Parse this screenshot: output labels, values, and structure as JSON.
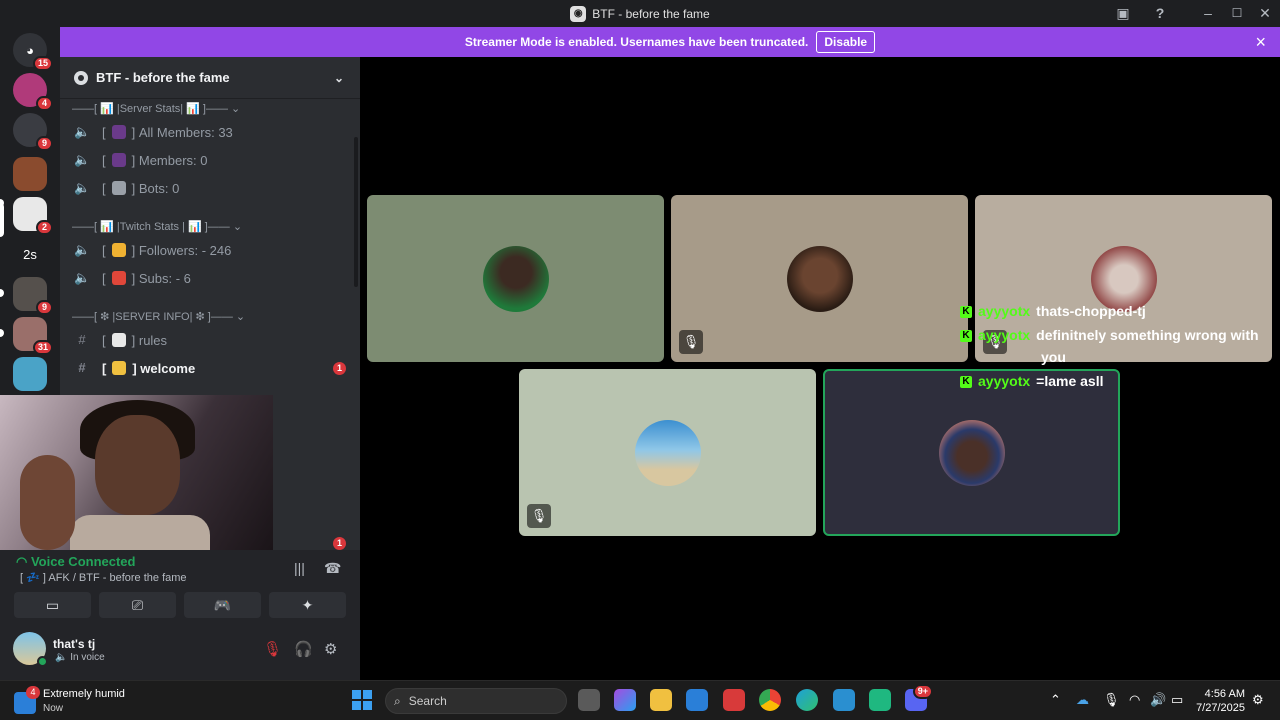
{
  "window": {
    "title": "BTF - before the fame"
  },
  "banner": {
    "text": "Streamer Mode is enabled. Usernames have been truncated.",
    "disable_label": "Disable",
    "close_glyph": "×"
  },
  "servers": [
    {
      "name": "discord-home",
      "badge": "15",
      "color": "#313338"
    },
    {
      "name": "server-2",
      "badge": "4",
      "color": "#b03a7a"
    },
    {
      "name": "server-3",
      "badge": "9",
      "color": "#3a3c42"
    },
    {
      "name": "server-4",
      "badge": "",
      "color": "#8a4b2e"
    },
    {
      "name": "server-5",
      "badge": "2",
      "color": "#e8e8e8"
    },
    {
      "name": "server-6",
      "label": "2s",
      "badge": "",
      "color": "#1e1f22"
    },
    {
      "name": "server-7",
      "badge": "9",
      "color": "#55504c"
    },
    {
      "name": "server-8",
      "badge": "31",
      "color": "#9a6f6a"
    },
    {
      "name": "server-9",
      "badge": "",
      "color": "#4aa3c7"
    }
  ],
  "sidebar": {
    "server_name": "BTF - before the fame",
    "categories": {
      "server_stats": "——[ 📊 |Server Stats| 📊 ]——",
      "twitch_stats": "——[ 📊 |Twitch Stats | 📊 ]——",
      "server_info": "——[ ❇ |SERVER INFO| ❇ ]——"
    },
    "channels": {
      "all_members": "All Members: 33",
      "members": "Members: 0",
      "bots": "Bots: 0",
      "followers": "Followers: - 246",
      "subs": "Subs: - 6",
      "rules": "rules",
      "welcome": "welcome"
    },
    "welcome_badge": "1",
    "lower_badge": "1"
  },
  "voice": {
    "status": "Voice Connected",
    "channel": "[ 💤 ]  AFK / BTF - before the fame"
  },
  "user": {
    "name": "that's tj",
    "status": "In voice"
  },
  "chat": [
    {
      "user": "ayyyotx",
      "message": "thats-chopped-tj"
    },
    {
      "user": "ayyyotx",
      "message": "definitnely something wrong with"
    },
    {
      "user": "",
      "message": "you"
    },
    {
      "user": "ayyyotx",
      "message": "=lame asll"
    }
  ],
  "taskbar": {
    "weather_badge": "4",
    "weather_title": "Extremely humid",
    "weather_sub": "Now",
    "search_placeholder": "Search",
    "time": "4:56 AM",
    "date": "7/27/2025",
    "discord_badge": "9+"
  }
}
